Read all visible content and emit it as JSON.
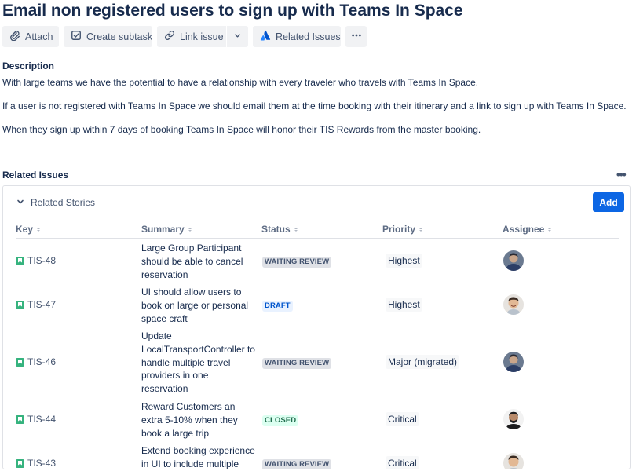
{
  "issue": {
    "title": "Email non registered users to sign up with Teams In Space"
  },
  "toolbar": {
    "attach": "Attach",
    "create_subtask": "Create subtask",
    "link_issue": "Link issue",
    "related_issues": "Related Issues"
  },
  "description": {
    "label": "Description",
    "paragraphs": [
      "With large teams we have the potential to have a relationship with every traveler who travels with Teams In Space.",
      "If a user is not registered with Teams In Space we should email them at the time booking with their itinerary and a link to sign up with Teams In Space.",
      "When they sign up within 7 days of booking Teams In Space will honor their TIS Rewards from the master booking."
    ]
  },
  "related": {
    "label": "Related Issues",
    "section_title": "Related Stories",
    "add_label": "Add",
    "columns": [
      "Key",
      "Summary",
      "Status",
      "Priority",
      "Assignee"
    ],
    "rows": [
      {
        "key": "TIS-48",
        "summary": "Large Group Participant should be able to cancel reservation",
        "status": "WAITING REVIEW",
        "priority": "Highest",
        "avatar": "avatar-dark-hair"
      },
      {
        "key": "TIS-47",
        "summary": "UI should allow users to book on large or personal space craft",
        "status": "DRAFT",
        "priority": "Highest",
        "avatar": "avatar-light-smile"
      },
      {
        "key": "TIS-46",
        "summary": "Update LocalTransportController to handle multiple travel providers in one reservation",
        "status": "WAITING REVIEW",
        "priority": "Major (migrated)",
        "avatar": "avatar-dark-hair"
      },
      {
        "key": "TIS-44",
        "summary": "Reward Customers an extra 5-10% when they book a large trip",
        "status": "CLOSED",
        "priority": "Critical",
        "avatar": "avatar-bearded"
      },
      {
        "key": "TIS-43",
        "summary": "Extend booking experience in UI to include multiple",
        "status": "WAITING REVIEW",
        "priority": "Critical",
        "avatar": "avatar-light-smile"
      }
    ]
  },
  "colors": {
    "accent": "#0c66e4",
    "story_green": "#36b37e",
    "text": "#172b4d"
  }
}
